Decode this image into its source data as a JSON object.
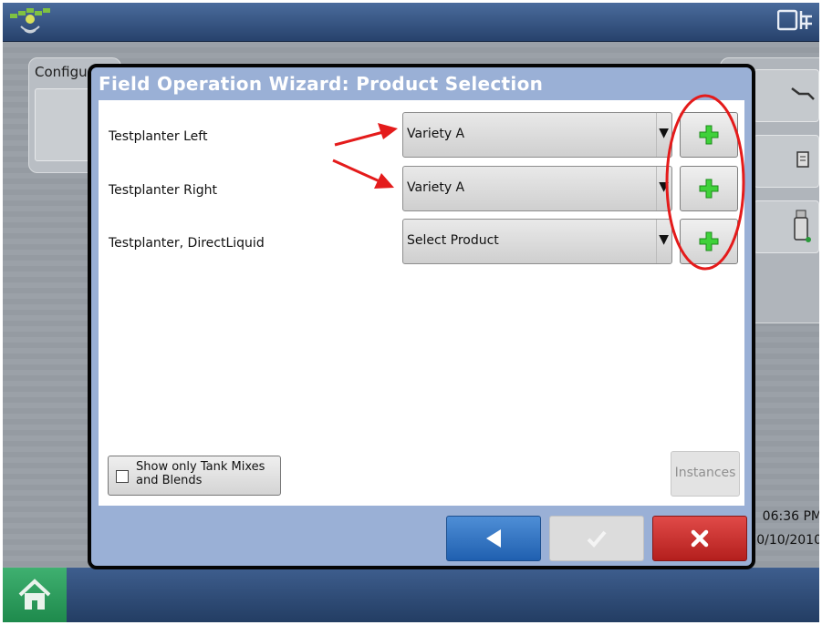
{
  "dialog": {
    "title": "Field Operation Wizard: Product Selection",
    "rows": [
      {
        "label": "Testplanter Left",
        "selected": "Variety A"
      },
      {
        "label": "Testplanter Right",
        "selected": "Variety A"
      },
      {
        "label": "Testplanter, DirectLiquid",
        "selected": "Select Product"
      }
    ],
    "tank_mix_checkbox": {
      "label": "Show only Tank Mixes and Blends",
      "checked": false
    },
    "instances_label": "Instances"
  },
  "background": {
    "config_label": "Configu",
    "time": "06:36 PM",
    "date": "0/10/2010"
  },
  "colors": {
    "title_bar": "#9ab0d6",
    "back_button": "#2f73c3",
    "cancel_button": "#c62f2d",
    "add_icon": "#3fd13a",
    "annotation": "#e41b1b"
  }
}
